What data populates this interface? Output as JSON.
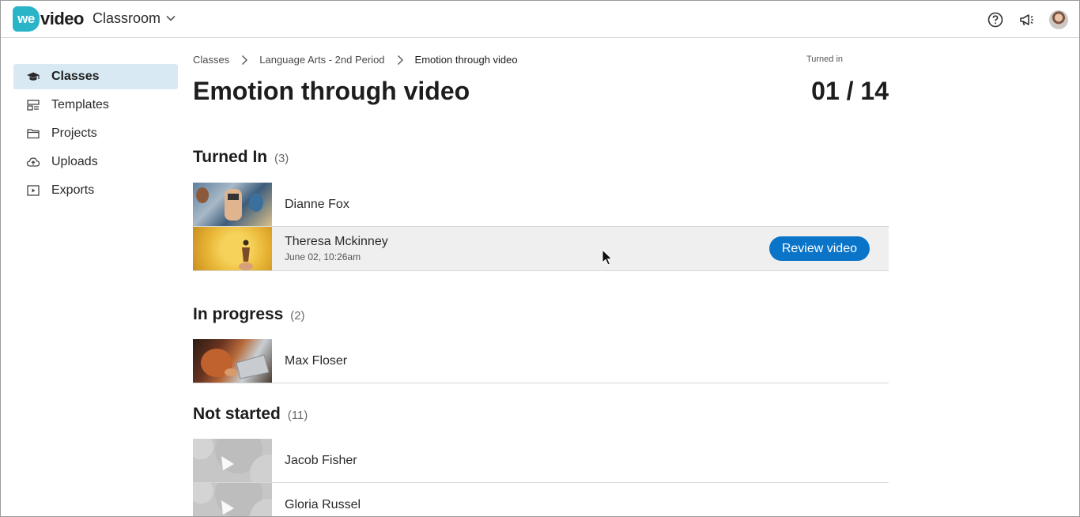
{
  "header": {
    "logo_badge": "we",
    "logo_text": "video",
    "app_name": "Classroom",
    "icons": [
      "help-icon",
      "announcements-icon"
    ]
  },
  "sidebar": {
    "items": [
      {
        "label": "Classes",
        "icon": "graduation-cap-icon",
        "active": true
      },
      {
        "label": "Templates",
        "icon": "templates-icon",
        "active": false
      },
      {
        "label": "Projects",
        "icon": "folder-icon",
        "active": false
      },
      {
        "label": "Uploads",
        "icon": "cloud-upload-icon",
        "active": false
      },
      {
        "label": "Exports",
        "icon": "play-square-icon",
        "active": false
      }
    ]
  },
  "breadcrumb": [
    "Classes",
    "Language Arts - 2nd Period",
    "Emotion through video"
  ],
  "assignment": {
    "title": "Emotion through video",
    "turned_in_label": "Turned in",
    "turned_in_count": "01 / 14"
  },
  "sections": {
    "turned_in": {
      "title": "Turned In",
      "count": "(3)",
      "students": [
        {
          "name": "Dianne Fox",
          "date": ""
        },
        {
          "name": "Theresa Mckinney",
          "date": "June 02, 10:26am",
          "action": "Review video"
        }
      ]
    },
    "in_progress": {
      "title": "In progress",
      "count": "(2)",
      "students": [
        {
          "name": "Max Floser"
        }
      ]
    },
    "not_started": {
      "title": "Not started",
      "count": "(11)",
      "students": [
        {
          "name": "Jacob Fisher"
        },
        {
          "name": "Gloria Russel"
        }
      ]
    }
  },
  "colors": {
    "accent": "#0a74c9",
    "active_nav": "#d8e9f4",
    "logo": "#2ab4c8"
  }
}
